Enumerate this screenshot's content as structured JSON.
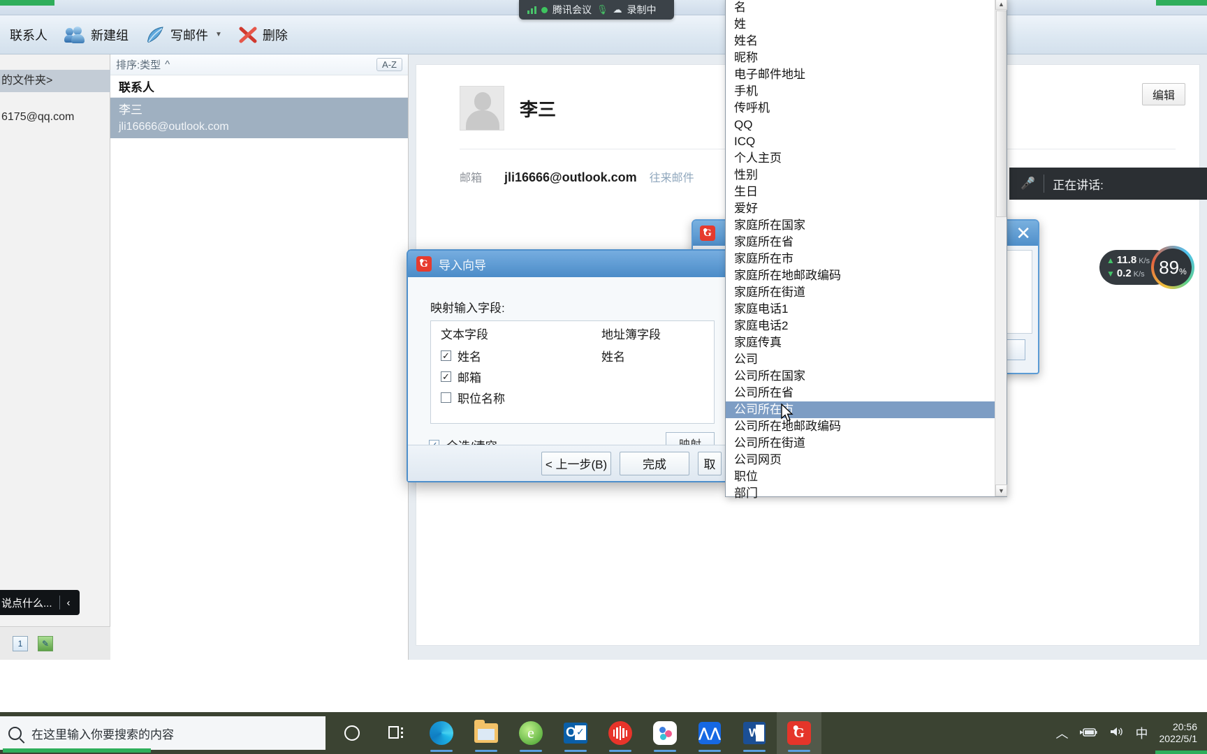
{
  "window": {
    "title": ""
  },
  "toolbar": {
    "items": [
      {
        "label": "联系人",
        "icon": "contacts-icon"
      },
      {
        "label": "新建组",
        "icon": "new-group-icon"
      },
      {
        "label": "写邮件",
        "icon": "compose-mail-icon",
        "caret": "▼"
      },
      {
        "label": "删除",
        "icon": "delete-icon"
      }
    ]
  },
  "left_panel": {
    "selected_row": "的文件夹>",
    "account_row": "6175@qq.com",
    "footer_buttons": [
      "1",
      "✎"
    ]
  },
  "contact_list": {
    "sort_label": "排序:类型",
    "sort_caret": "^",
    "az_button": "A-Z",
    "group_header": "联系人",
    "items": [
      {
        "name": "李三",
        "email": "jli16666@outlook.com"
      }
    ]
  },
  "detail": {
    "name": "李三",
    "email_label": "邮箱",
    "email_value": "jli16666@outlook.com",
    "email_link": "往来邮件",
    "edit_button": "编辑"
  },
  "meeting_pill": {
    "app": "腾讯会议",
    "recording": "录制中"
  },
  "speaking_bar": {
    "label": "正在讲话:"
  },
  "net_widget": {
    "upload": "11.8",
    "upload_unit": "K/s",
    "download": "0.2",
    "download_unit": "K/s",
    "percent": "89",
    "percent_sign": "%"
  },
  "background_dialog": {
    "close": "✕"
  },
  "wizard": {
    "title": "导入向导",
    "map_label": "映射输入字段:",
    "table": {
      "headers": [
        "文本字段",
        "地址簿字段"
      ],
      "rows": [
        {
          "checked": true,
          "text_field": "姓名",
          "addressbook_field": "姓名"
        },
        {
          "checked": true,
          "text_field": "邮箱",
          "addressbook_field": ""
        },
        {
          "checked": false,
          "text_field": "职位名称",
          "addressbook_field": ""
        }
      ]
    },
    "select_all": {
      "checked": true,
      "label": "全选/清空"
    },
    "map_button": "映射",
    "buttons": {
      "back": "< 上一步(B)",
      "finish": "完成",
      "extra": "取"
    }
  },
  "dropdown": {
    "items": [
      "名",
      "姓",
      "姓名",
      "昵称",
      "电子邮件地址",
      "手机",
      "传呼机",
      "QQ",
      "ICQ",
      "个人主页",
      "性别",
      "生日",
      "爱好",
      "家庭所在国家",
      "家庭所在省",
      "家庭所在市",
      "家庭所在地邮政编码",
      "家庭所在街道",
      "家庭电话1",
      "家庭电话2",
      "家庭传真",
      "公司",
      "公司所在国家",
      "公司所在省",
      "公司所在市",
      "公司所在地邮政编码",
      "公司所在街道",
      "公司网页",
      "职位",
      "部门"
    ],
    "selected_index": 24,
    "scroll_up": "▲",
    "scroll_down": "▼"
  },
  "overlay_pill": {
    "text": "说点什么...",
    "collapse": "‹"
  },
  "taskbar": {
    "search_placeholder": "在这里输入你要搜索的内容",
    "apps": [
      {
        "name": "cortana-icon"
      },
      {
        "name": "task-view-icon"
      },
      {
        "name": "edge-icon"
      },
      {
        "name": "file-explorer-icon"
      },
      {
        "name": "internet-explorer-icon"
      },
      {
        "name": "outlook-icon"
      },
      {
        "name": "recorder-icon"
      },
      {
        "name": "meeting-app-icon"
      },
      {
        "name": "blue-app-icon"
      },
      {
        "name": "word-icon"
      },
      {
        "name": "foxmail-icon"
      }
    ],
    "tray": {
      "chevron": "︿",
      "battery": "🔋",
      "volume": "🔊",
      "ime": "中",
      "time": "20:56",
      "date": "2022/5/1"
    }
  }
}
